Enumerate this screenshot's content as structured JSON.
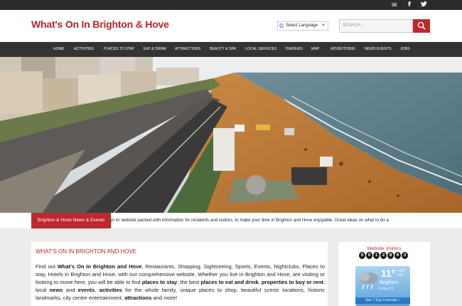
{
  "topbar": {
    "icons": [
      "email-icon",
      "facebook-icon",
      "twitter-icon"
    ],
    "email_glyph": "✉",
    "facebook_glyph": "f",
    "twitter_glyph": "🐦"
  },
  "header": {
    "logo": "What's On In Brighton & Hove",
    "translate_label": "Select Language",
    "translate_arrow": "▼",
    "search_placeholder": "SEARCH ..."
  },
  "nav": {
    "items": [
      "HOME",
      "ACTIVITIES",
      "PLACES TO STAY",
      "EAT & DRINK",
      "ATTRACTIONS",
      "BEAUTY & SPA",
      "LOCAL SERVICES",
      "TRADERS",
      "MAP",
      "ADVERTISING",
      "NEWS EVENTS",
      "JOBS"
    ]
  },
  "ticker": {
    "label": "Brighton & Hove News & Events",
    "text": "go to' website packed with information for residents and visitors, to make your time in Brighton and Hove enjoyable. Great ideas on what to do a"
  },
  "main": {
    "title": "WHAT'S ON IN BRIGHTON AND HOVE",
    "t1": "Find out ",
    "b1": "What's On In Brighton and Hove",
    "t2": ", Restaurants, Shopping, Sightseeing, Sports, Events, Nightclubs, Places to stay, Hotels in Brighton and Hove, with our comprehensive website. Whether you live in Brighton and Hove, are visiting or looking to move here, you will be able to find ",
    "b2": "places to stay",
    "t3": ", the best ",
    "b3": "places to eat and drink",
    "t4": ", ",
    "b4": "properties to buy or rent",
    "t5": ", local ",
    "b5": "news",
    "t6": " and ",
    "b6": "events",
    "t7": ", ",
    "b7": "activities",
    "t8": " for the whole family, unique places to shop, beautiful scenic locations, historic landmarks, city centre entertainment, ",
    "b8": "attractions",
    "t9": " and more!"
  },
  "sidebar": {
    "visitors_title": "Website Visitors",
    "counter_digits": [
      "0",
      "0",
      "1",
      "2",
      "8",
      "6",
      "3"
    ],
    "weather": {
      "temp": "11°",
      "high": "+12°",
      "low": "+8°",
      "city": "Brighton",
      "date": "Friday, 01",
      "forecast": "See 7-Day Forecast »"
    }
  },
  "colors": {
    "brand_red": "#c0282e",
    "nav_bg": "#343434",
    "topbar_bg": "#2b2b2b"
  }
}
